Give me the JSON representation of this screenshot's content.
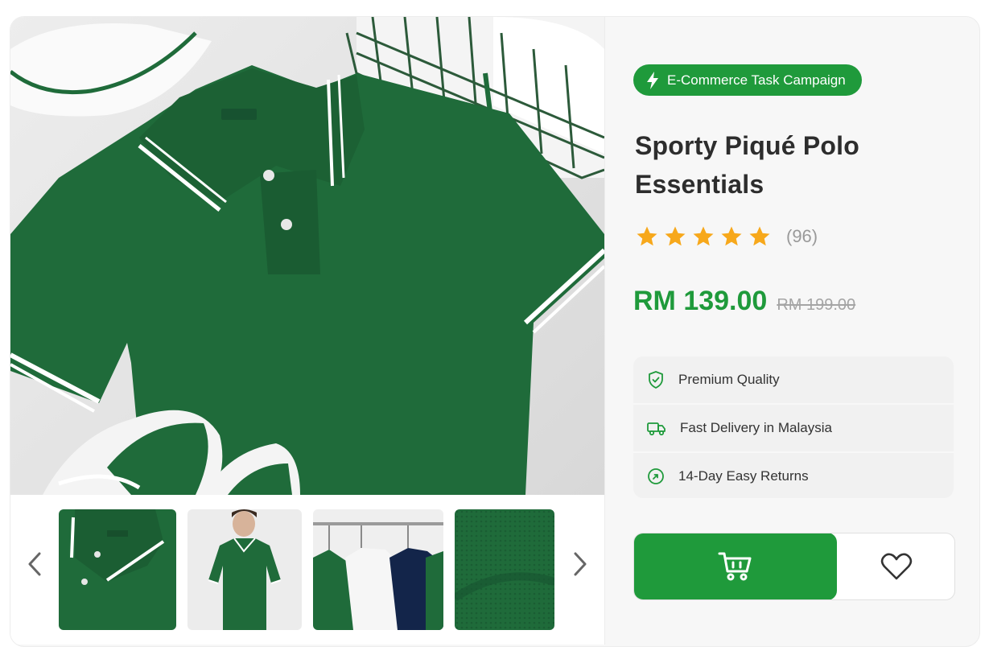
{
  "campaign_badge": {
    "label": "E-Commerce Task Campaign",
    "icon": "lightning-icon"
  },
  "product": {
    "title": "Sporty Piqué Polo Essentials",
    "rating": {
      "stars": 5,
      "max_stars": 5,
      "review_count": "(96)"
    },
    "price_current": "RM 139.00",
    "price_original": "RM 199.00"
  },
  "features": [
    {
      "icon": "shield-check-icon",
      "label": "Premium Quality"
    },
    {
      "icon": "truck-icon",
      "label": "Fast Delivery in Malaysia"
    },
    {
      "icon": "return-icon",
      "label": "14-Day Easy Returns"
    }
  ],
  "actions": {
    "add_to_cart_icon": "cart-icon",
    "wishlist_icon": "heart-icon"
  },
  "gallery": {
    "main_image": "green polo shirt flat lay with cap, basket and sneakers",
    "thumbnails": [
      "collar-close-up",
      "model-wearing-polo",
      "polos-on-rack",
      "fabric-texture"
    ],
    "prev_icon": "chevron-left-icon",
    "next_icon": "chevron-right-icon"
  },
  "colors": {
    "accent": "#1f9a3b",
    "shirt": "#1f6b3a",
    "star": "#f7a81b",
    "text": "#2d2d2d"
  }
}
